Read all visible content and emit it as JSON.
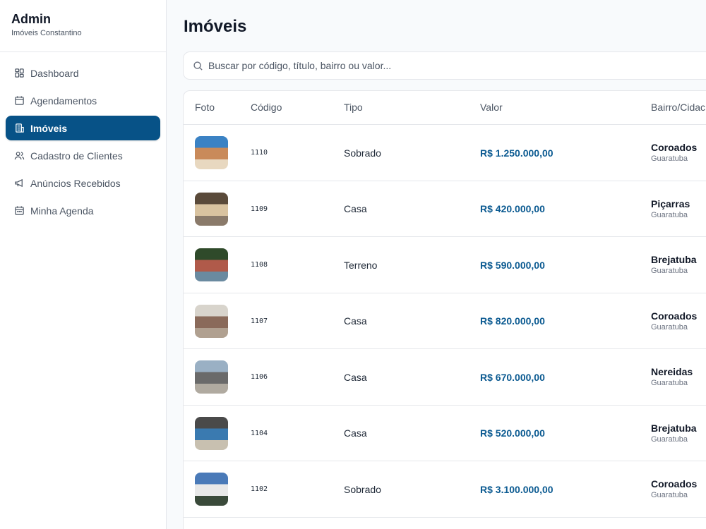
{
  "sidebar": {
    "brand_title": "Admin",
    "brand_subtitle": "Imóveis Constantino",
    "items": [
      {
        "label": "Dashboard",
        "icon": "dashboard-icon",
        "active": false
      },
      {
        "label": "Agendamentos",
        "icon": "calendar-icon",
        "active": false
      },
      {
        "label": "Imóveis",
        "icon": "building-icon",
        "active": true
      },
      {
        "label": "Cadastro de Clientes",
        "icon": "users-icon",
        "active": false
      },
      {
        "label": "Anúncios Recebidos",
        "icon": "megaphone-icon",
        "active": false
      },
      {
        "label": "Minha Agenda",
        "icon": "calendar-icon",
        "active": false
      }
    ]
  },
  "main": {
    "title": "Imóveis",
    "search": {
      "placeholder": "Buscar por código, título, bairro ou valor..."
    },
    "table": {
      "headers": [
        "Foto",
        "Código",
        "Tipo",
        "Valor",
        "Bairro/Cidac"
      ],
      "rows": [
        {
          "codigo": "1110",
          "tipo": "Sobrado",
          "valor": "R$ 1.250.000,00",
          "bairro": "Coroados",
          "cidade": "Guaratuba",
          "photo_colors": [
            "#3b82c4",
            "#c98a5a",
            "#e8d8c0"
          ]
        },
        {
          "codigo": "1109",
          "tipo": "Casa",
          "valor": "R$ 420.000,00",
          "bairro": "Piçarras",
          "cidade": "Guaratuba",
          "photo_colors": [
            "#5a4a3a",
            "#d9c3a0",
            "#8a7a6a"
          ]
        },
        {
          "codigo": "1108",
          "tipo": "Terreno",
          "valor": "R$ 590.000,00",
          "bairro": "Brejatuba",
          "cidade": "Guaratuba",
          "photo_colors": [
            "#2f4a2a",
            "#b05a4a",
            "#6a8aa0"
          ]
        },
        {
          "codigo": "1107",
          "tipo": "Casa",
          "valor": "R$ 820.000,00",
          "bairro": "Coroados",
          "cidade": "Guaratuba",
          "photo_colors": [
            "#d8d4cc",
            "#8a6a5a",
            "#b0a090"
          ]
        },
        {
          "codigo": "1106",
          "tipo": "Casa",
          "valor": "R$ 670.000,00",
          "bairro": "Nereidas",
          "cidade": "Guaratuba",
          "photo_colors": [
            "#9ab0c4",
            "#6a6a6a",
            "#b0aaa0"
          ]
        },
        {
          "codigo": "1104",
          "tipo": "Casa",
          "valor": "R$ 520.000,00",
          "bairro": "Brejatuba",
          "cidade": "Guaratuba",
          "photo_colors": [
            "#4a4a4a",
            "#3a7ab0",
            "#c8c0b0"
          ]
        },
        {
          "codigo": "1102",
          "tipo": "Sobrado",
          "valor": "R$ 3.100.000,00",
          "bairro": "Coroados",
          "cidade": "Guaratuba",
          "photo_colors": [
            "#4a7ab8",
            "#e8e8e8",
            "#3a4a3a"
          ]
        }
      ]
    }
  },
  "colors": {
    "accent": "#075287",
    "value_text": "#0b5a91"
  }
}
